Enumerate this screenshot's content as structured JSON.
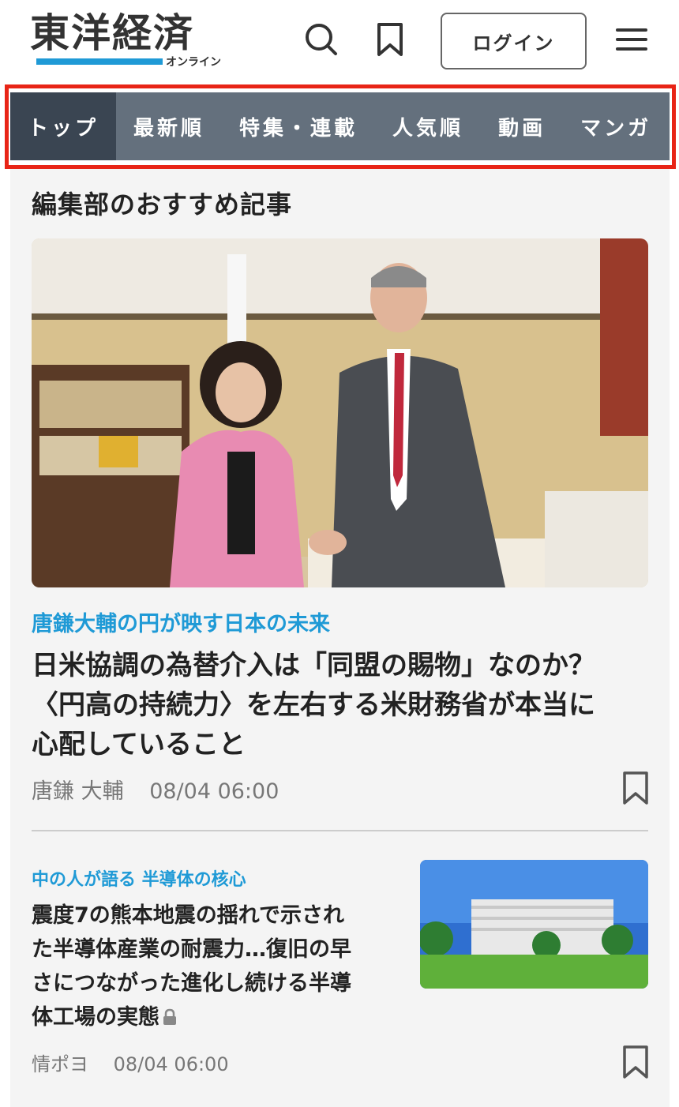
{
  "header": {
    "logo_text": "東洋経済",
    "logo_sub": "オンライン",
    "login_label": "ログイン",
    "icons": [
      "search-icon",
      "bookmark-icon",
      "hamburger-menu-icon"
    ]
  },
  "nav": {
    "tabs": [
      {
        "label": "トップ",
        "active": true
      },
      {
        "label": "最新順"
      },
      {
        "label": "特集・連載"
      },
      {
        "label": "人気順"
      },
      {
        "label": "動画"
      },
      {
        "label": "マンガ"
      }
    ]
  },
  "section": {
    "title": "編集部のおすすめ記事"
  },
  "articles": [
    {
      "category": "唐鎌大輔の円が映す日本の未来",
      "title_lines": [
        "日米協調の為替介入は「同盟の賜物」なのか？",
        "〈円高の持続力〉を左右する米財務省が本当に",
        "心配していること"
      ],
      "author": "唐鎌 大輔",
      "date": "08/04 06:00"
    },
    {
      "category": "中の人が語る 半導体の核心",
      "title_lines": [
        "震度7の熊本地震の揺れで示され",
        "た半導体産業の耐震力…復旧の早",
        "さにつながった進化し続ける半導",
        "体工場の実態"
      ],
      "author": "情ポヨ",
      "date": "08/04 06:00",
      "locked": true
    }
  ],
  "colors": {
    "accent_blue": "#1f9ad6",
    "nav_bg": "#64707d",
    "nav_active": "#3a4552",
    "highlight_border": "#e82416"
  }
}
